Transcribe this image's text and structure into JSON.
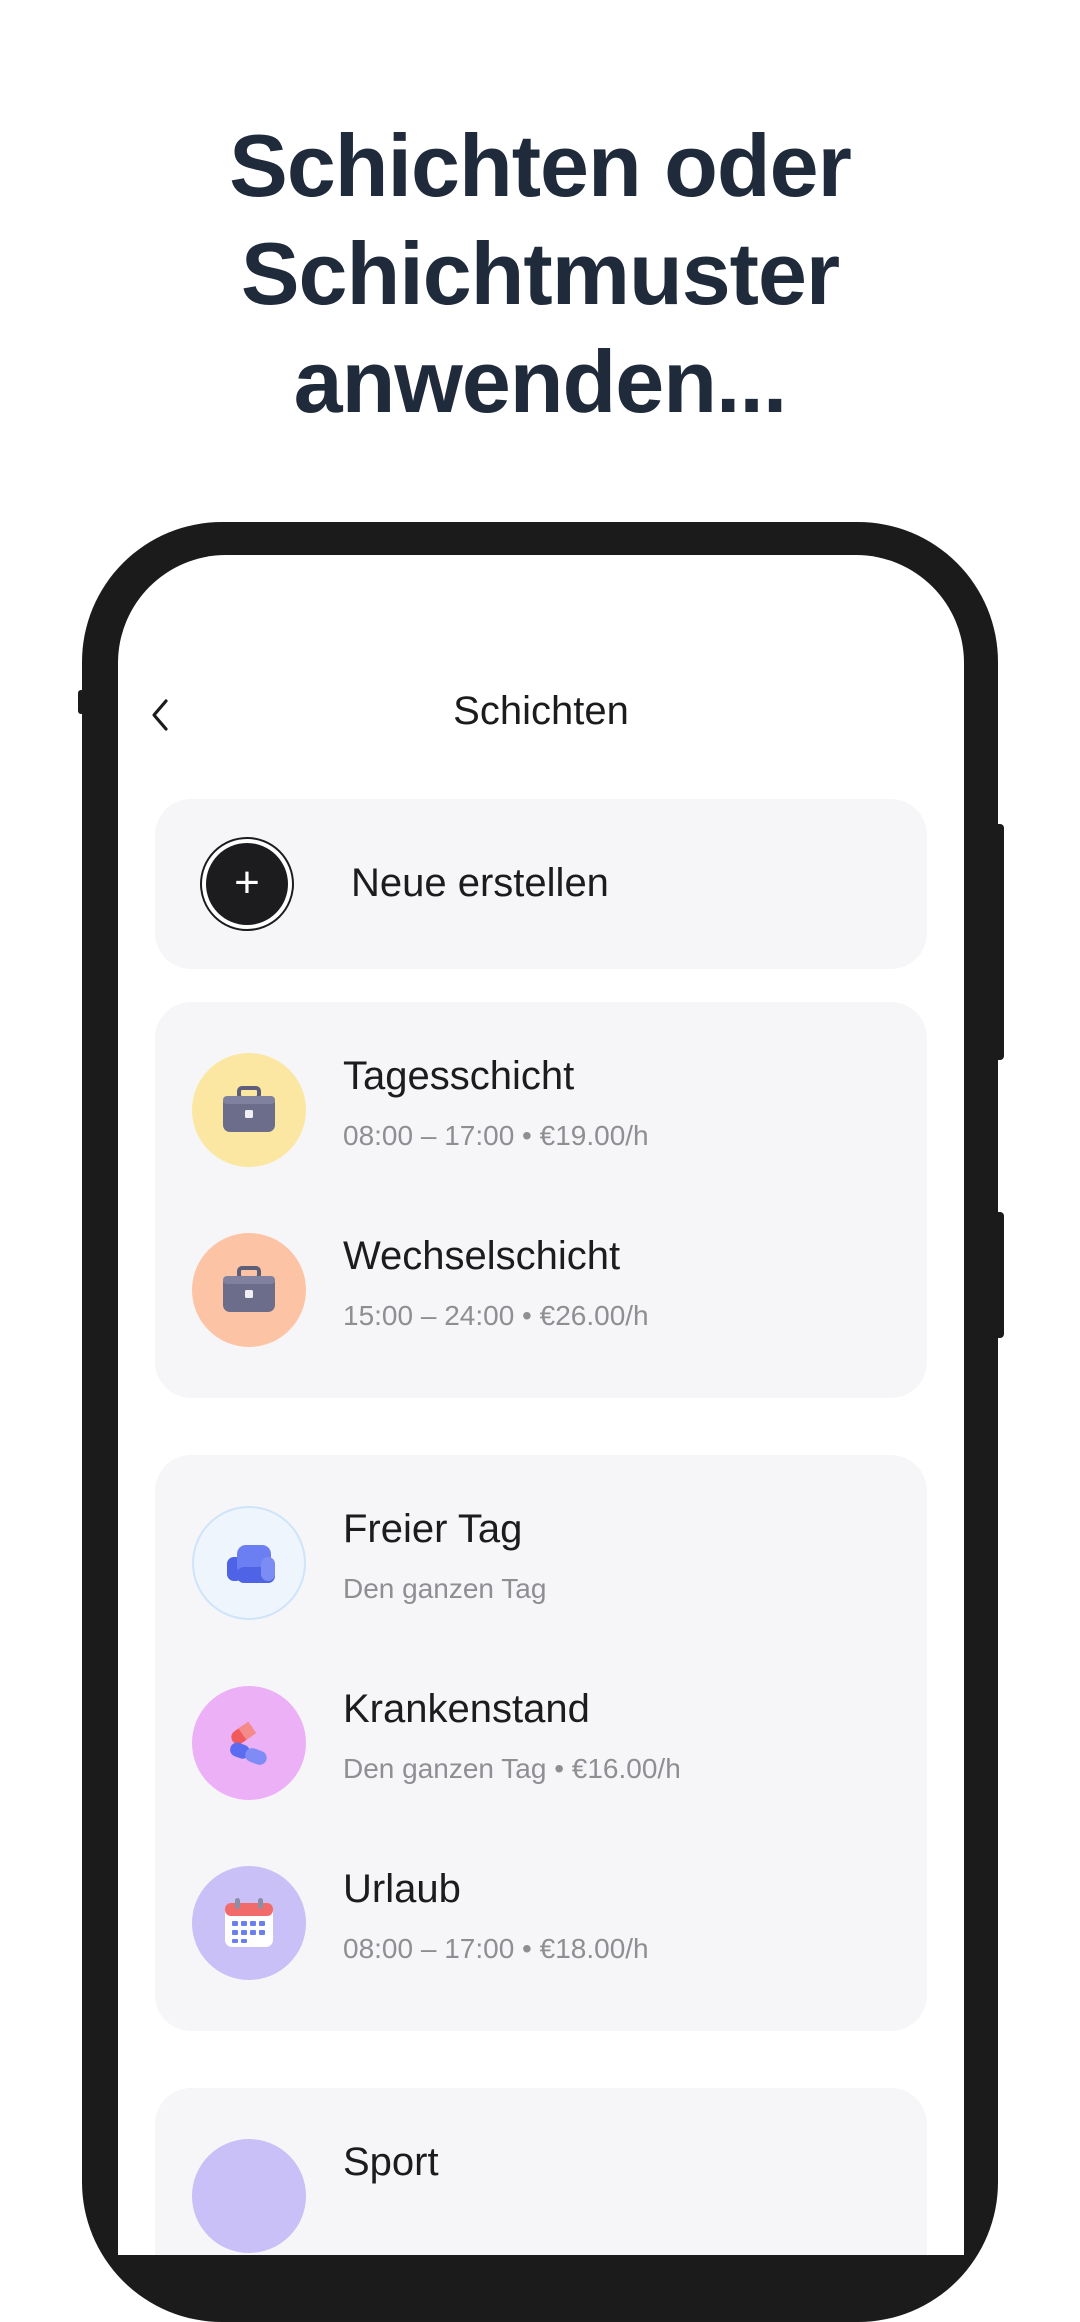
{
  "headline": [
    "Schichten oder",
    "Schichtmuster",
    "anwenden..."
  ],
  "screen": {
    "title": "Schichten",
    "new_label": "Neue erstellen",
    "groups": [
      {
        "items": [
          {
            "title": "Tagesschicht",
            "subtitle": "08:00 – 17:00 • €19.00/h",
            "icon": "briefcase-icon",
            "color": "#fbe7a1"
          },
          {
            "title": "Wechselschicht",
            "subtitle": "15:00 – 24:00 • €26.00/h",
            "icon": "briefcase-icon",
            "color": "#fcc4a4"
          }
        ]
      },
      {
        "items": [
          {
            "title": "Freier Tag",
            "subtitle": "Den ganzen Tag",
            "icon": "armchair-icon",
            "color": "#eef5fd"
          },
          {
            "title": "Krankenstand",
            "subtitle": "Den ganzen Tag • €16.00/h",
            "icon": "pills-icon",
            "color": "#ecb0f7"
          },
          {
            "title": "Urlaub",
            "subtitle": "08:00 – 17:00 • €18.00/h",
            "icon": "calendar-icon",
            "color": "#c8c0f6"
          }
        ]
      },
      {
        "items": [
          {
            "title": "Sport",
            "icon": "sport-icon",
            "color": "#c8c0f6"
          }
        ]
      }
    ]
  },
  "colors": {
    "headline": "#1f2a3a",
    "frame": "#1b1b1c",
    "card": "#f6f6f8",
    "text_secondary": "#8e8e93"
  }
}
